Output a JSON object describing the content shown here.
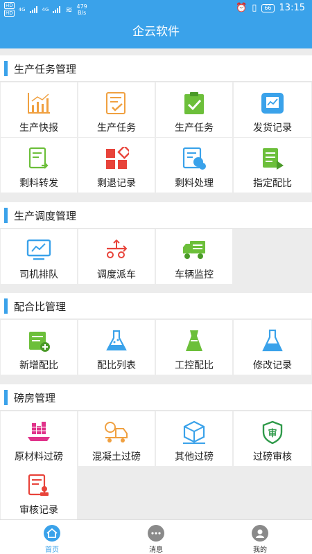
{
  "status_bar": {
    "network_top": "HD",
    "network_bottom": "HD",
    "g1": "4G",
    "g2": "4G",
    "speed_value": "479",
    "speed_unit": "B/s",
    "battery": "66",
    "time": "13:15"
  },
  "header": {
    "title": "企云软件"
  },
  "sections": [
    {
      "title": "生产任务管理",
      "items": [
        {
          "label": "生产快报",
          "icon": "bar-chart-icon"
        },
        {
          "label": "生产任务",
          "icon": "task-list-icon"
        },
        {
          "label": "生产任务",
          "icon": "clipboard-check-icon"
        },
        {
          "label": "发货记录",
          "icon": "delivery-chart-icon"
        },
        {
          "label": "剩料转发",
          "icon": "forward-doc-icon"
        },
        {
          "label": "剩退记录",
          "icon": "blocks-icon"
        },
        {
          "label": "剩料处理",
          "icon": "process-doc-icon"
        },
        {
          "label": "指定配比",
          "icon": "assign-ratio-icon"
        }
      ]
    },
    {
      "title": "生产调度管理",
      "items": [
        {
          "label": "司机排队",
          "icon": "monitor-icon"
        },
        {
          "label": "调度派车",
          "icon": "dispatch-icon"
        },
        {
          "label": "车辆监控",
          "icon": "truck-icon"
        }
      ]
    },
    {
      "title": "配合比管理",
      "items": [
        {
          "label": "新增配比",
          "icon": "add-ratio-icon"
        },
        {
          "label": "配比列表",
          "icon": "flask-icon"
        },
        {
          "label": "工控配比",
          "icon": "tower-icon"
        },
        {
          "label": "修改记录",
          "icon": "beaker-icon"
        }
      ]
    },
    {
      "title": "磅房管理",
      "items": [
        {
          "label": "原材料过磅",
          "icon": "scale-icon"
        },
        {
          "label": "混凝土过磅",
          "icon": "mixer-truck-icon"
        },
        {
          "label": "其他过磅",
          "icon": "box-icon"
        },
        {
          "label": "过磅审核",
          "icon": "shield-audit-icon"
        },
        {
          "label": "审核记录",
          "icon": "audit-record-icon"
        }
      ]
    }
  ],
  "bottom_nav": [
    {
      "label": "首页",
      "icon": "home-icon"
    },
    {
      "label": "消息",
      "icon": "message-icon"
    },
    {
      "label": "我的",
      "icon": "profile-icon"
    }
  ],
  "colors": {
    "primary": "#3aa2ea",
    "orange": "#f0a040",
    "green": "#6cbf3a",
    "red": "#e8433a"
  }
}
